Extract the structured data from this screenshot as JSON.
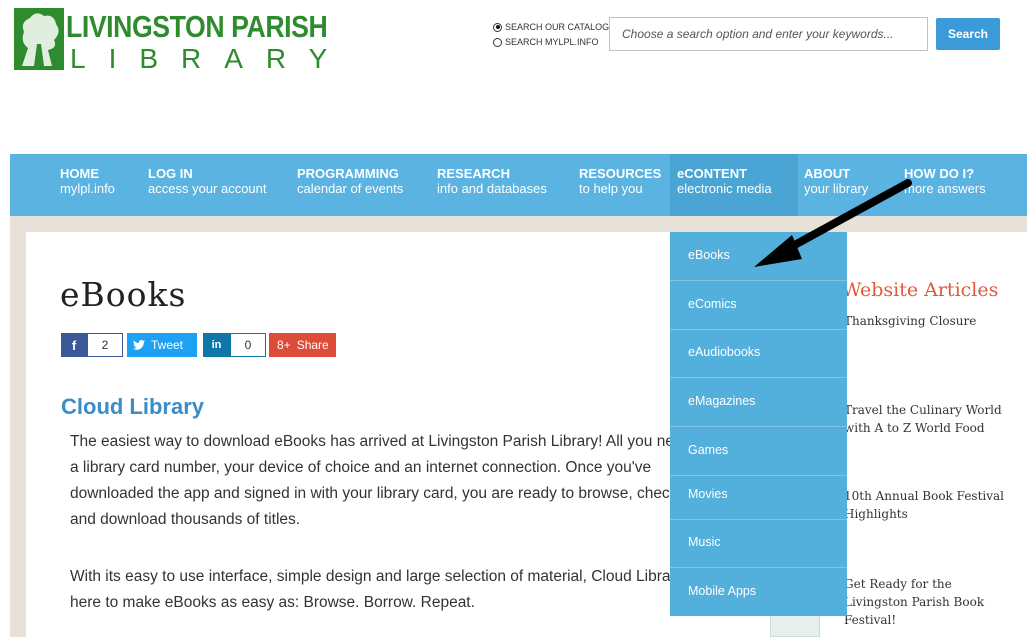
{
  "header": {
    "logo_line1": "LIVINGSTON PARISH",
    "logo_line2": "LIBRARY",
    "search_options": [
      {
        "label": "SEARCH OUR CATALOG",
        "selected": true
      },
      {
        "label": "SEARCH MYLPL.INFO",
        "selected": false
      }
    ],
    "search_placeholder": "Choose a search option and enter your keywords...",
    "search_button": "Search"
  },
  "nav": [
    {
      "title": "HOME",
      "subtitle": "mylpl.info"
    },
    {
      "title": "LOG IN",
      "subtitle": "access your account"
    },
    {
      "title": "PROGRAMMING",
      "subtitle": "calendar of events"
    },
    {
      "title": "RESEARCH",
      "subtitle": "info and databases"
    },
    {
      "title": "RESOURCES",
      "subtitle": "to help you"
    },
    {
      "title": "eCONTENT",
      "subtitle": "electronic media"
    },
    {
      "title": "ABOUT",
      "subtitle": "your library"
    },
    {
      "title": "HOW DO I?",
      "subtitle": "more answers"
    }
  ],
  "page": {
    "title": "eBooks",
    "share": {
      "facebook_count": "2",
      "tweet_label": "Tweet",
      "linkedin_count": "0",
      "gplus_label": "Share",
      "facebook_icon": "f",
      "linkedin_icon": "in",
      "gplus_icon": "8+"
    },
    "section_heading": "Cloud Library",
    "paragraph1": "The easiest way to download eBooks has arrived at Livingston Parish Library! All you need is a library card number, your device of choice and an internet connection. Once you've downloaded the app and signed in with your library card, you are ready to browse, checkout and download thousands of titles.",
    "paragraph2": "With its easy to use interface, simple design and large selection of material, Cloud Library is here to make eBooks as easy as: Browse. Borrow. Repeat."
  },
  "sidebar": {
    "heading": "Website Articles",
    "articles": [
      "Thanksgiving Closure",
      "Travel the Culinary World with A to Z World Food",
      "10th Annual Book Festival Highlights",
      "Get Ready for the Livingston Parish Book Festival!"
    ]
  },
  "dropdown": [
    "eBooks",
    "eComics",
    "eAudiobooks",
    "eMagazines",
    "Games",
    "Movies",
    "Music",
    "Mobile Apps"
  ],
  "colors": {
    "nav_bg": "#5ab3e0",
    "dropdown_bg": "#53afdc",
    "logo_green": "#2e8b2e",
    "heading_blue": "#3a8dc6",
    "sidebar_heading": "#e0593b"
  },
  "icons": [
    "tree-logo-icon",
    "facebook-icon",
    "twitter-icon",
    "linkedin-icon",
    "google-plus-icon",
    "annotation-arrow-icon"
  ]
}
